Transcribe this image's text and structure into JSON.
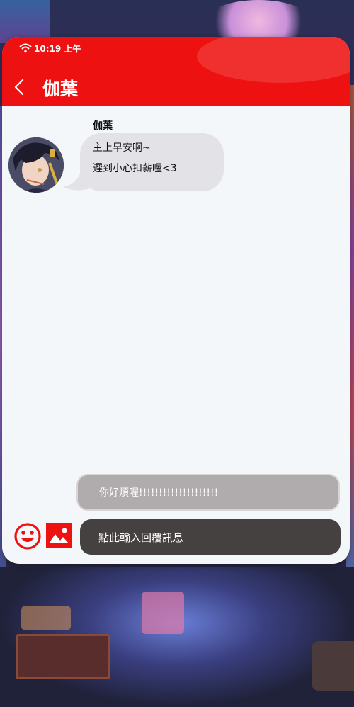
{
  "status_bar": {
    "time": "10:19 上午",
    "icons": [
      "wifi-icon"
    ]
  },
  "header": {
    "title": "伽葉",
    "back_icon": "back-chevron-icon"
  },
  "conversation": {
    "messages": [
      {
        "sender": "伽葉",
        "lines": [
          "主上早安啊~",
          "遲到小心扣薪喔<3"
        ],
        "avatar": "avatar"
      }
    ]
  },
  "composer": {
    "suggestion": "你好煩喔!!!!!!!!!!!!!!!!!!!!",
    "input_placeholder": "點此輸入回覆訊息",
    "emoji_icon": "smiley-icon",
    "image_icon": "image-icon"
  },
  "colors": {
    "accent": "#ee1111",
    "surface": "#f3f7fa",
    "bubble": "#e3e2e6",
    "suggestion": "#b0acad",
    "input": "#454141"
  }
}
